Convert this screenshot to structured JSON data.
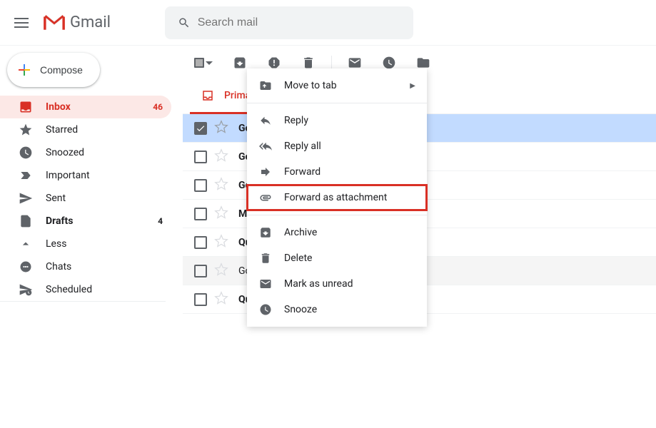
{
  "header": {
    "logo_text": "Gmail",
    "search_placeholder": "Search mail"
  },
  "sidebar": {
    "compose_label": "Compose",
    "items": [
      {
        "icon": "inbox",
        "label": "Inbox",
        "count": "46",
        "active": true
      },
      {
        "icon": "star",
        "label": "Starred"
      },
      {
        "icon": "clock",
        "label": "Snoozed"
      },
      {
        "icon": "important",
        "label": "Important"
      },
      {
        "icon": "send",
        "label": "Sent"
      },
      {
        "icon": "draft",
        "label": "Drafts",
        "count": "4",
        "bold": true
      },
      {
        "icon": "less",
        "label": "Less"
      },
      {
        "icon": "chats",
        "label": "Chats"
      },
      {
        "icon": "scheduled",
        "label": "Scheduled"
      }
    ]
  },
  "category_tab": {
    "label": "Prima"
  },
  "emails": [
    {
      "sender": "Go",
      "selected": true
    },
    {
      "sender": "Go"
    },
    {
      "sender": "Go"
    },
    {
      "sender": "Ma"
    },
    {
      "sender": "Qu"
    },
    {
      "sender": "Go",
      "read": true
    },
    {
      "sender": "Qu"
    }
  ],
  "context_menu": {
    "items": [
      {
        "icon": "folder",
        "label": "Move to tab",
        "has_arrow": true
      },
      {
        "divider": true
      },
      {
        "icon": "reply",
        "label": "Reply"
      },
      {
        "icon": "reply-all",
        "label": "Reply all"
      },
      {
        "icon": "forward",
        "label": "Forward"
      },
      {
        "icon": "attachment",
        "label": "Forward as attachment",
        "highlighted": true
      },
      {
        "divider": true
      },
      {
        "icon": "archive",
        "label": "Archive"
      },
      {
        "icon": "delete",
        "label": "Delete"
      },
      {
        "icon": "unread",
        "label": "Mark as unread"
      },
      {
        "icon": "snooze",
        "label": "Snooze"
      }
    ]
  }
}
